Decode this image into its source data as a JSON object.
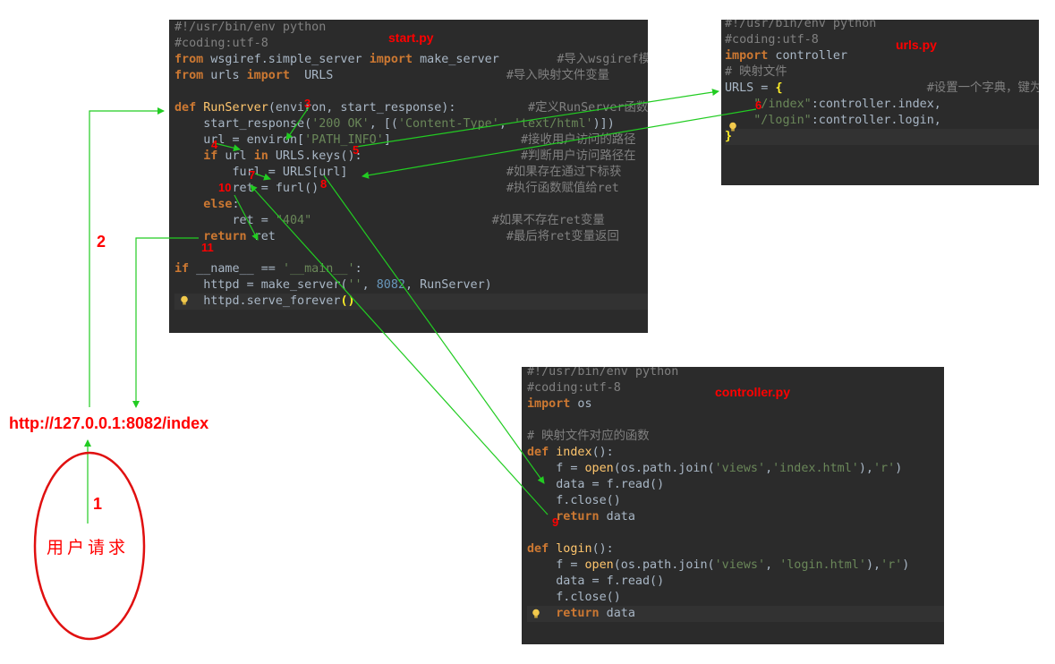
{
  "start_panel": {
    "title": "start.py",
    "lines": [
      [
        {
          "t": "#!/usr/bin/env python",
          "c": "cm"
        }
      ],
      [
        {
          "t": "#coding:utf-8",
          "c": "cm"
        }
      ],
      [
        {
          "t": "from",
          "c": "kw"
        },
        {
          "t": " wsgiref.simple_server "
        },
        {
          "t": "import",
          "c": "kw"
        },
        {
          "t": " make_server        "
        },
        {
          "t": "#导入wsgiref模块里",
          "c": "cm"
        }
      ],
      [
        {
          "t": "from",
          "c": "kw"
        },
        {
          "t": " urls "
        },
        {
          "t": "import",
          "c": "kw"
        },
        {
          "t": "  URLS                        "
        },
        {
          "t": "#导入映射文件变量",
          "c": "cm"
        }
      ],
      [],
      [
        {
          "t": "def",
          "c": "kw"
        },
        {
          "t": " "
        },
        {
          "t": "RunServer",
          "c": "fn"
        },
        {
          "t": "(environ, start_response):          "
        },
        {
          "t": "#定义RunServer函数",
          "c": "cm"
        }
      ],
      [
        {
          "t": "    start_response("
        },
        {
          "t": "'200 OK'",
          "c": "st"
        },
        {
          "t": ", [("
        },
        {
          "t": "'Content-Type'",
          "c": "st"
        },
        {
          "t": ", "
        },
        {
          "t": "'text/html'",
          "c": "st"
        },
        {
          "t": ")])"
        }
      ],
      [
        {
          "t": "    url = environ["
        },
        {
          "t": "'PATH_INFO'",
          "c": "st"
        },
        {
          "t": "]                  "
        },
        {
          "t": "#接收用户访问的路径",
          "c": "cm"
        }
      ],
      [
        {
          "t": "    "
        },
        {
          "t": "if",
          "c": "kw"
        },
        {
          "t": " url "
        },
        {
          "t": "in",
          "c": "kw"
        },
        {
          "t": " URLS.keys():                      "
        },
        {
          "t": "#判断用户访问路径在",
          "c": "cm"
        }
      ],
      [
        {
          "t": "        furl = URLS[url]                      "
        },
        {
          "t": "#如果存在通过下标获",
          "c": "cm"
        }
      ],
      [
        {
          "t": "        ret = furl()                          "
        },
        {
          "t": "#执行函数赋值给ret",
          "c": "cm"
        }
      ],
      [
        {
          "t": "    "
        },
        {
          "t": "else",
          "c": "kw"
        },
        {
          "t": ":"
        }
      ],
      [
        {
          "t": "        ret = "
        },
        {
          "t": "\"404\"",
          "c": "st"
        },
        {
          "t": "                         "
        },
        {
          "t": "#如果不存在ret变量",
          "c": "cm"
        }
      ],
      [
        {
          "t": "    "
        },
        {
          "t": "return",
          "c": "kw"
        },
        {
          "t": " ret                                "
        },
        {
          "t": "#最后将ret变量返回",
          "c": "cm"
        }
      ],
      [],
      [
        {
          "t": "if",
          "c": "kw"
        },
        {
          "t": " __name__ == "
        },
        {
          "t": "'__main__'",
          "c": "st"
        },
        {
          "t": ":"
        }
      ],
      [
        {
          "t": "    httpd = make_server("
        },
        {
          "t": "''",
          "c": "st"
        },
        {
          "t": ", "
        },
        {
          "t": "8082",
          "c": "nm"
        },
        {
          "t": ", RunServer)"
        }
      ],
      [
        {
          "t": "    httpd.serve_forever"
        },
        {
          "t": "()",
          "c": "br"
        }
      ]
    ]
  },
  "urls_panel": {
    "title": "urls.py",
    "lines": [
      [
        {
          "t": "#!/usr/bin/env python",
          "c": "cm"
        }
      ],
      [
        {
          "t": "#coding:utf-8",
          "c": "cm"
        }
      ],
      [
        {
          "t": "import",
          "c": "kw"
        },
        {
          "t": " controller"
        }
      ],
      [
        {
          "t": "# 映射文件",
          "c": "cm"
        }
      ],
      [
        {
          "t": "URLS = "
        },
        {
          "t": "{",
          "c": "br"
        },
        {
          "t": "                    "
        },
        {
          "t": "#设置一个字典，键为路",
          "c": "cm"
        }
      ],
      [
        {
          "t": "    "
        },
        {
          "t": "\"/index\"",
          "c": "st"
        },
        {
          "t": ":controller.index,"
        }
      ],
      [
        {
          "t": "    "
        },
        {
          "t": "\"/login\"",
          "c": "st"
        },
        {
          "t": ":controller.login,"
        }
      ],
      [
        {
          "t": "}",
          "c": "br"
        }
      ]
    ]
  },
  "controller_panel": {
    "title": "controller.py",
    "lines": [
      [
        {
          "t": "#!/usr/bin/env python",
          "c": "cm"
        }
      ],
      [
        {
          "t": "#coding:utf-8",
          "c": "cm"
        }
      ],
      [
        {
          "t": "import",
          "c": "kw"
        },
        {
          "t": " os"
        }
      ],
      [],
      [
        {
          "t": "# 映射文件对应的函数",
          "c": "cm"
        }
      ],
      [
        {
          "t": "def",
          "c": "kw"
        },
        {
          "t": " "
        },
        {
          "t": "index",
          "c": "fn"
        },
        {
          "t": "():"
        }
      ],
      [
        {
          "t": "    f = "
        },
        {
          "t": "open",
          "c": "fn"
        },
        {
          "t": "(os.path.join("
        },
        {
          "t": "'views'",
          "c": "st"
        },
        {
          "t": ","
        },
        {
          "t": "'index.html'",
          "c": "st"
        },
        {
          "t": "),"
        },
        {
          "t": "'r'",
          "c": "st"
        },
        {
          "t": ")"
        }
      ],
      [
        {
          "t": "    data = f.read()"
        }
      ],
      [
        {
          "t": "    f.close()"
        }
      ],
      [
        {
          "t": "    "
        },
        {
          "t": "return",
          "c": "kw"
        },
        {
          "t": " data"
        }
      ],
      [],
      [
        {
          "t": "def",
          "c": "kw"
        },
        {
          "t": " "
        },
        {
          "t": "login",
          "c": "fn"
        },
        {
          "t": "():"
        }
      ],
      [
        {
          "t": "    f = "
        },
        {
          "t": "open",
          "c": "fn"
        },
        {
          "t": "(os.path.join("
        },
        {
          "t": "'views'",
          "c": "st"
        },
        {
          "t": ", "
        },
        {
          "t": "'login.html'",
          "c": "st"
        },
        {
          "t": "),"
        },
        {
          "t": "'r'",
          "c": "st"
        },
        {
          "t": ")"
        }
      ],
      [
        {
          "t": "    data = f.read()"
        }
      ],
      [
        {
          "t": "    f.close()"
        }
      ],
      [
        {
          "t": "    "
        },
        {
          "t": "return",
          "c": "kw"
        },
        {
          "t": " data"
        }
      ]
    ]
  },
  "url_text": "http://127.0.0.1:8082/index",
  "user_request": "用户请求",
  "step_labels": {
    "s1": "1",
    "s2": "2",
    "s3": "3",
    "s4": "4",
    "s5": "5",
    "s6": "6",
    "s7": "7",
    "s8": "8",
    "s9": "9",
    "s10": "10",
    "s11": "11"
  },
  "colors": {
    "editor_bg": "#2b2b2b",
    "arrow": "#22cc22",
    "annotation": "#ff0000"
  }
}
